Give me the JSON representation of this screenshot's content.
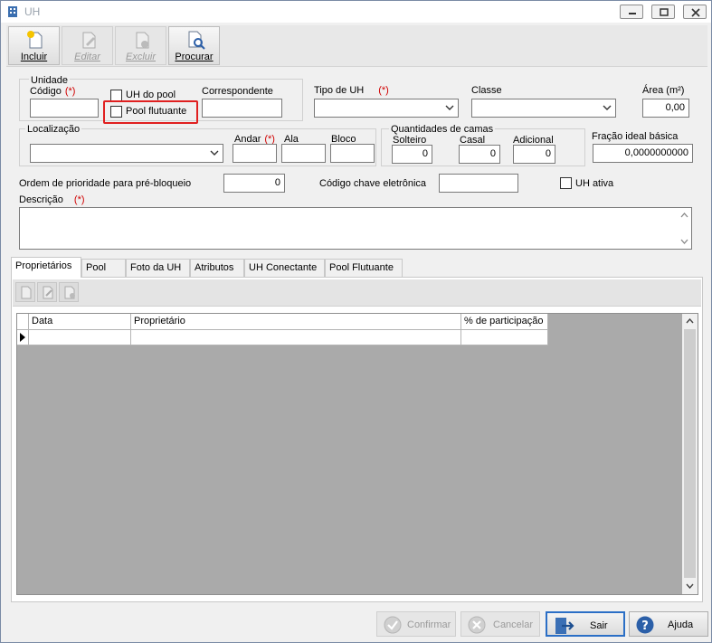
{
  "window": {
    "title": "UH"
  },
  "toolbar": {
    "incluir": "Incluir",
    "editar": "Editar",
    "excluir": "Excluir",
    "procurar": "Procurar"
  },
  "unidade": {
    "group_label": "Unidade",
    "codigo_label": "Código",
    "required_marker": "(*)",
    "uh_do_pool_label": "UH do pool",
    "pool_flutuante_label": "Pool flutuante",
    "correspondente_label": "Correspondente"
  },
  "tipo_uh": {
    "label": "Tipo de UH",
    "required": "(*)"
  },
  "classe": {
    "label": "Classe"
  },
  "area": {
    "label": "Área (m²)",
    "value": "0,00"
  },
  "localizacao": {
    "label": "Localização",
    "andar_label": "Andar",
    "andar_required": "(*)",
    "ala_label": "Ala",
    "bloco_label": "Bloco"
  },
  "camas": {
    "group_label": "Quantidades de camas",
    "solteiro_label": "Solteiro",
    "solteiro_value": "0",
    "casal_label": "Casal",
    "casal_value": "0",
    "adicional_label": "Adicional",
    "adicional_value": "0"
  },
  "fracao": {
    "label": "Fração ideal básica",
    "value": "0,0000000000"
  },
  "ordem": {
    "label": "Ordem de prioridade para pré-bloqueio",
    "value": "0"
  },
  "codigo_chave": {
    "label": "Código chave eletrônica"
  },
  "uh_ativa": {
    "label": "UH ativa"
  },
  "descricao": {
    "label": "Descrição",
    "required": "(*)"
  },
  "tabs": [
    "Proprietários",
    "Pool",
    "Foto da UH",
    "Atributos",
    "UH Conectante",
    "Pool Flutuante"
  ],
  "grid": {
    "columns": [
      "Data",
      "Proprietário",
      "% de participação"
    ]
  },
  "buttons": {
    "confirmar": "Confirmar",
    "cancelar": "Cancelar",
    "sair": "Sair",
    "ajuda": "Ajuda"
  },
  "colors": {
    "required": "#d00000",
    "highlight": "#e02020",
    "accent": "#2b6fc6"
  }
}
